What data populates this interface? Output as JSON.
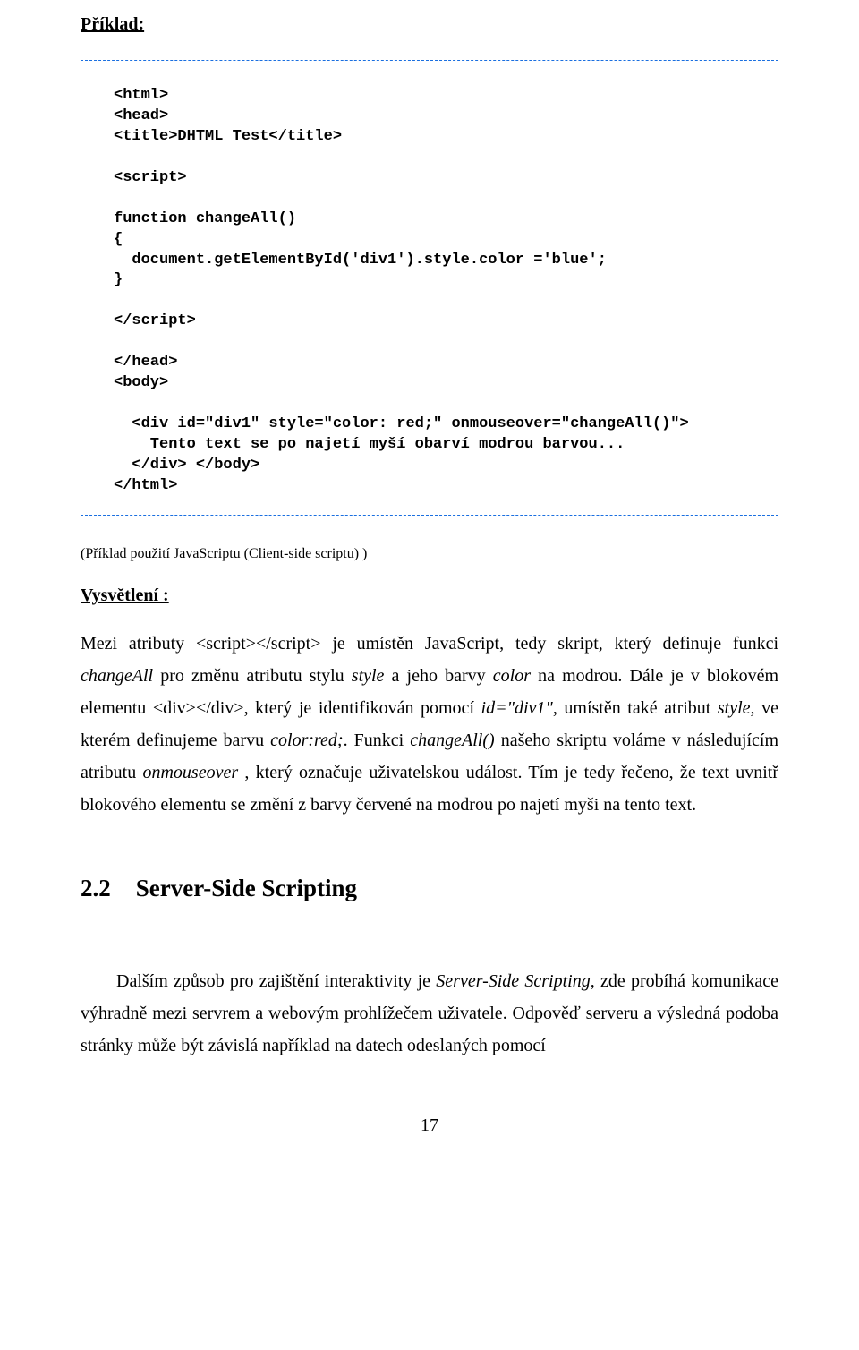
{
  "header": {
    "label": "Příklad:"
  },
  "code": {
    "lines": [
      "<html>",
      "<head>",
      "<title>DHTML Test</title>",
      "",
      "<script>",
      "",
      "function changeAll()",
      "{",
      "  document.getElementById('div1').style.color ='blue';",
      "}",
      "",
      "</script>",
      "",
      "</head>",
      "<body>",
      "",
      "  <div id=\"div1\" style=\"color: red;\" onmouseover=\"changeAll()\">",
      "    Tento text se po najetí myší obarví modrou barvou...",
      "  </div> </body>",
      "</html>"
    ]
  },
  "caption": "(Příklad použití JavaScriptu (Client-side scriptu) )",
  "explain": {
    "label": "Vysvětlení :"
  },
  "para1": {
    "t1": "Mezi atributy <script></script> je umístěn JavaScript, tedy skript, který definuje funkci ",
    "i1": "changeAll",
    "t2": " pro změnu atributu stylu ",
    "i2": "style",
    "t3": "  a jeho barvy ",
    "i3": "color",
    "t4": " na modrou. Dále je v blokovém elementu <div></div>, který je identifikován pomocí  ",
    "i4": "id=\"div1\"",
    "t5": ", umístěn také atribut ",
    "i5": "style,",
    "t6": " ve kterém definujeme barvu ",
    "i6": "color:red;",
    "t7": ". Funkci ",
    "i7": "changeAll()",
    "t8": " našeho skriptu voláme v následujícím atributu ",
    "i8": "onmouseover",
    "t9": " , který označuje uživatelskou událost. Tím je tedy řečeno, že text uvnitř blokového elementu se změní z barvy červené na modrou po najetí myši na tento text."
  },
  "section": {
    "num": "2.2",
    "title": "Server-Side Scripting"
  },
  "para2": {
    "t1": "Dalším způsob pro zajištění interaktivity je ",
    "i1": "Server-Side Scripting,",
    "t2": " zde probíhá komunikace výhradně mezi servrem a webovým prohlížečem uživatele. Odpověď serveru a výsledná podoba stránky může být závislá například na datech odeslaných pomocí"
  },
  "pageNumber": "17"
}
